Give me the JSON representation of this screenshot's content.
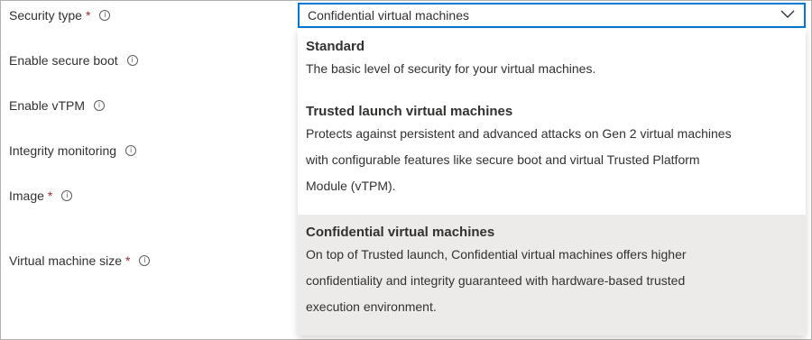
{
  "form": {
    "security_type_label": "Security type",
    "secure_boot_label": "Enable secure boot",
    "vtpm_label": "Enable vTPM",
    "integrity_label": "Integrity monitoring",
    "image_label": "Image",
    "vm_size_label": "Virtual machine size",
    "required_marker": "*",
    "info_glyph": "i"
  },
  "select": {
    "value": "Confidential virtual machines",
    "icon": "chevron-down-icon"
  },
  "options": [
    {
      "title": "Standard",
      "description": "The basic level of security for your virtual machines."
    },
    {
      "title": "Trusted launch virtual machines",
      "description": "Protects against persistent and advanced attacks on Gen 2 virtual machines\nwith configurable features like secure boot and virtual Trusted Platform\nModule (vTPM)."
    },
    {
      "title": "Confidential virtual machines",
      "description": "On top of Trusted launch, Confidential virtual machines offers higher\nconfidentiality and integrity guaranteed with hardware-based trusted\nexecution environment.",
      "selected": true
    }
  ],
  "colors": {
    "focus_border": "#0078d4",
    "required": "#a4262c",
    "selected_bg": "#edebe9"
  }
}
